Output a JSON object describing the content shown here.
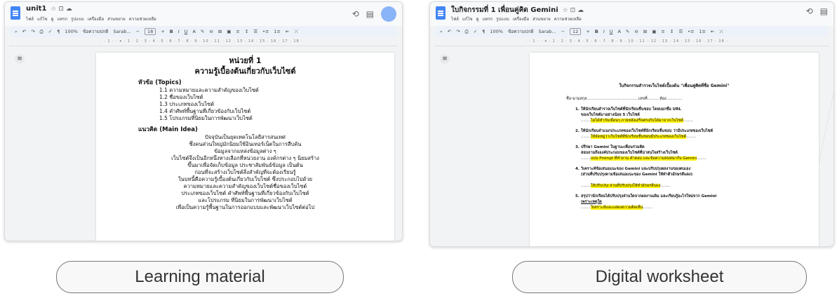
{
  "left": {
    "doc_title": "unit1",
    "menu": [
      "ไฟล์",
      "แก้ไข",
      "ดู",
      "แทรก",
      "รูปแบบ",
      "เครื่องมือ",
      "ส่วนขยาย",
      "ความช่วยเหลือ"
    ],
    "toolbar": {
      "zoom": "100%",
      "style": "ข้อความปกติ",
      "font": "Sarab...",
      "font_size": "18"
    },
    "content": {
      "unit": "หน่วยที่ 1",
      "title": "ความรู้เบื้องต้นเกี่ยวกับเว็บไซต์",
      "topics_heading": "หัวข้อ (Topics)",
      "topics": [
        "1.1 ความหมายและความสำคัญของเว็บไซต์",
        "1.2 ชื่อของเว็บไซต์",
        "1.3 ประเภทของเว็บไซต์",
        "1.4 คำศัพท์พื้นฐานที่เกี่ยวข้องกับเว็บไซต์",
        "1.5 โปรแกรมที่นิยมในการพัฒนาเว็บไซต์"
      ],
      "main_idea_heading": "แนวคิด (Main Idea)",
      "main_idea_lines": [
        "ปัจจุบันเป็นยุคเทคโนโลยีสารสนเทศ",
        "ซึ่งคนส่วนใหญ่มักนิยมใช้อินเทอร์เน็ตในการสืบค้น",
        "ข้อมูลจากแหล่งข้อมูลต่าง ๆ",
        "เว็บไซต์จึงเป็นอีกหนึ่งทางเลือกที่หน่วยงาน องค์กรต่าง ๆ นิยมสร้าง",
        "ขึ้นมาเพื่อจัดเก็บข้อมูล ประชาสัมพันธ์ข้อมูล เป็นต้น",
        "ก่อนที่จะสร้างเว็บไซต์สิ่งสำคัญที่จะต้องเรียนรู้",
        "ในบทนี้คือความรู้เบื้องต้นเกี่ยวกับเว็บไซต์ ซึ่งประกอบไปด้วย",
        "ความหมายและความสำคัญของเว็บไซต์ชื่อของเว็บไซต์",
        "ประเภทของเว็บไซต์ คำศัพท์พื้นฐานที่เกี่ยวข้องกับเว็บไซต์",
        "และโปรแกรม ที่นิยมในการพัฒนาเว็บไซต์",
        "เพื่อเป็นความรู้พื้นฐานในการออกแบบและพัฒนาเว็บไซต์ต่อไป"
      ]
    },
    "caption": "Learning material"
  },
  "right": {
    "doc_title": "ใบกิจกรรมที่ 1 เพื่อนคู่คิด Gemini",
    "menu": [
      "ไฟล์",
      "แก้ไข",
      "ดู",
      "แทรก",
      "รูปแบบ",
      "เครื่องมือ",
      "ส่วนขยาย",
      "ความช่วยเหลือ"
    ],
    "toolbar": {
      "zoom": "100%",
      "style": "ข้อความปกติ",
      "font": "Sarab...",
      "font_size": "12"
    },
    "content": {
      "title": "ใบกิจกรรมสำรวจเว็บไซต์เบื้องต้น \"เพื่อนคู่คิดที่ชื่อ Gemini\"",
      "name_line": "ชื่อ-นามสกุล..........................................เลขที่..........ห้อง.............",
      "questions": [
        {
          "num": "1.",
          "lines": [
            "ให้นักเรียนสำรวจเว็บไซต์ที่นักเรียนชื่นชอบ โดยบอกชื่อ URL",
            "ของเว็บไซต์มาอย่างน้อย 5 เว็บไซต์"
          ],
          "answer": "ไม่ได้ทำกับเพื่อนๆ ภายหลังเสร็จตรงกับได้มาจากเว็บไซต์"
        },
        {
          "num": "2.",
          "lines": [
            "ให้นักเรียนจำแนกประเภทของเว็บไซต์ที่นักเรียนชื่นชอบ ว่ามีประเภทของเว็บไซต์"
          ],
          "answer": "ให้จัดหมู่ว่าเว็บไซต์ที่นักเรียนชื่นชอบมีประเภทของเว็บไซต์"
        },
        {
          "num": "3.",
          "lines": [
            "ปรึกษา Gemini ในฐานะเพื่อนร่วมคิด",
            "สอบถามถึงองค์ประกอบของเว็บไซต์ที่น่าสนใจสร้างเว็บไซต์"
          ],
          "answer": "แบบ Prompt ที่ทำถาม คำตอบ และข้อความสนทนากับ Gemini"
        },
        {
          "num": "4.",
          "lines": [
            "วิเคราะห์ข้อเสนอแนะของ Gemini และปรับปรุงผลงานของตนเอง",
            "(ส่วนที่ปรับปรุงตามข้อเสนอแนะของ Gemini ให้ทำตัวอักษรสีแดง)"
          ],
          "answer": "ให้ปรับปรุง ส่วนที่ปรับปรุงให้ทำอักษรสีแดง"
        },
        {
          "num": "5.",
          "lines": [
            "สรุปว่านักเรียนได้ปรับปรุงส่วนใดจากผลงานเดิม และเรียนรู้อะไรใหม่จาก Gemini",
            "เพราะเหตุใด"
          ],
          "answer": "วิเคราะห์และแสดงความคิดเห็น"
        }
      ]
    },
    "caption": "Digital worksheet"
  }
}
